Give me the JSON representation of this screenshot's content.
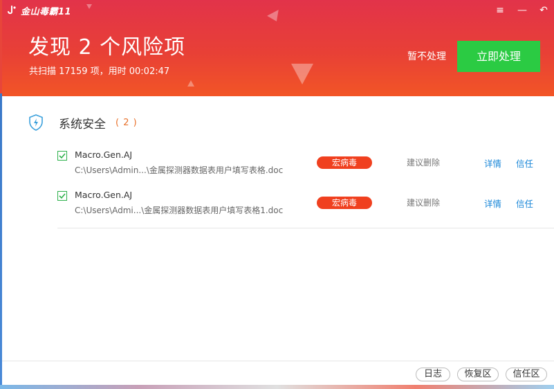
{
  "app": {
    "name": "金山毒霸11"
  },
  "header": {
    "title": "发现 2 个风险项",
    "subtitle": "共扫描 17159 项，用时 00:02:47",
    "skip_label": "暂不处理",
    "handle_now_label": "立即处理"
  },
  "window_controls": {
    "menu_icon": "≡",
    "minimize_icon": "—",
    "back_icon": "↶"
  },
  "section": {
    "title": "系统安全",
    "count": "( 2 )"
  },
  "threats": [
    {
      "name": "Macro.Gen.AJ",
      "path": "C:\\Users\\Admin...\\金属探测器数据表用户填写表格.doc",
      "type": "宏病毒",
      "advice": "建议删除",
      "details": "详情",
      "trust": "信任"
    },
    {
      "name": "Macro.Gen.AJ",
      "path": "C:\\Users\\Admi...\\金属探测器数据表用户填写表格1.doc",
      "type": "宏病毒",
      "advice": "建议删除",
      "details": "详情",
      "trust": "信任"
    }
  ],
  "footer": {
    "log": "日志",
    "restore": "恢复区",
    "trust_zone": "信任区"
  },
  "colors": {
    "header_red": "#e84036",
    "accent_green": "#2bcb43",
    "badge_red": "#f0401f",
    "link_blue": "#1a87d8",
    "count_orange": "#e8702a"
  }
}
